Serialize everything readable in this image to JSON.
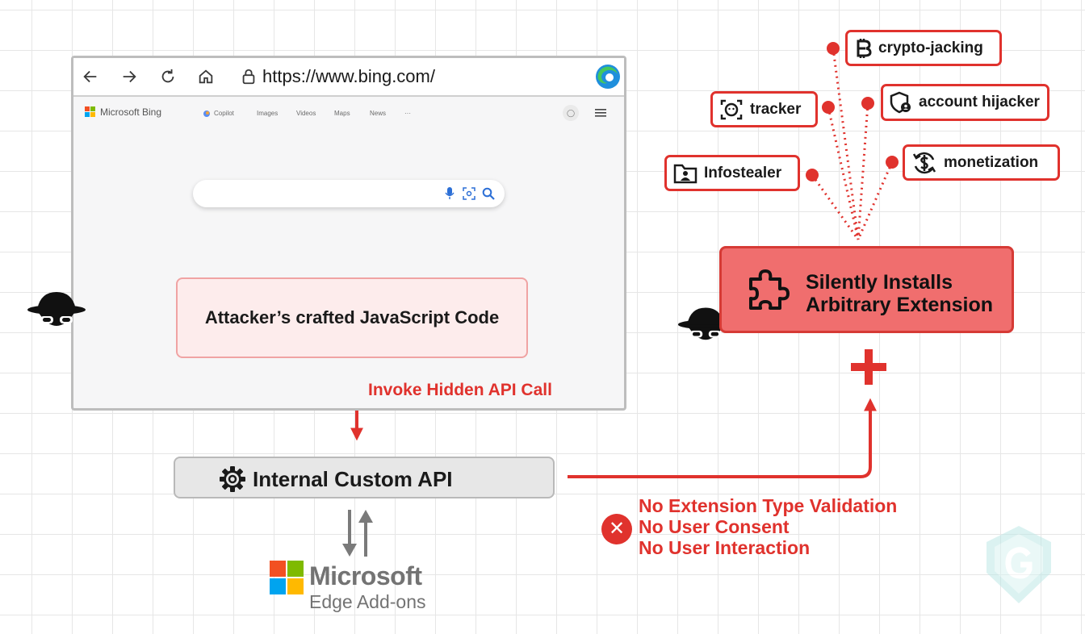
{
  "browser": {
    "url": "https://www.bing.com/",
    "bing": {
      "logo_text": "Microsoft Bing",
      "nav": [
        "Copilot",
        "Images",
        "Videos",
        "Maps",
        "News",
        "···"
      ]
    }
  },
  "attacker_code": "Attacker’s crafted JavaScript Code",
  "invoke_label": "Invoke Hidden API Call",
  "api_label": "Internal Custom API",
  "store": {
    "name": "Microsoft",
    "sub": "Edge Add-ons"
  },
  "warnings": [
    "No Extension Type Validation",
    "No User Consent",
    "No User Interaction"
  ],
  "install": {
    "line1": "Silently Installs",
    "line2": "Arbitrary Extension"
  },
  "payloads": {
    "crypto": "crypto-jacking",
    "tracker": "tracker",
    "hijacker": "account hijacker",
    "infostealer": "Infostealer",
    "monetization": "monetization"
  },
  "colors": {
    "accent": "#e0322d",
    "install_fill": "#f06e6e",
    "code_fill": "#fdecec"
  }
}
